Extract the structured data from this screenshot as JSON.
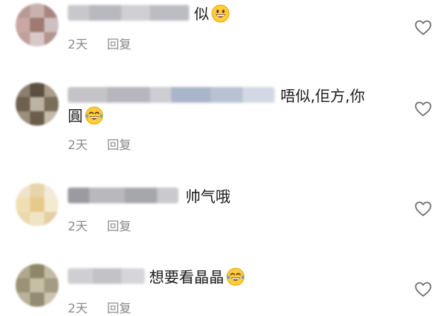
{
  "comments": [
    {
      "text": "似",
      "emoji": "grinning-face",
      "time": "2天",
      "reply_label": "回复"
    },
    {
      "text_line1": "唔似,佢方,你",
      "text_line2": "圓",
      "emoji": "tears-of-joy-face",
      "time": "2天",
      "reply_label": "回复"
    },
    {
      "text": "帅气哦",
      "time": "2天",
      "reply_label": "回复"
    },
    {
      "text": "想要看晶晶",
      "emoji": "tears-of-joy-face",
      "time": "2天",
      "reply_label": "回复"
    }
  ],
  "colors": {
    "text": "#1a1a1a",
    "meta": "#8a8a8a",
    "icon": "#6b6b6b",
    "emoji_face": "#ffcc3d",
    "emoji_tear": "#5aa9e6"
  }
}
